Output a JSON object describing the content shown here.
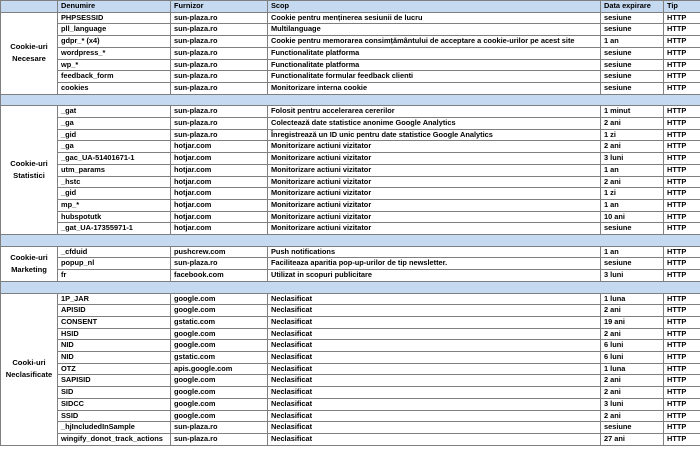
{
  "table": {
    "headers": [
      "",
      "Denumire",
      "Furnizor",
      "Scop",
      "Data expirare",
      "Tip"
    ],
    "groups": [
      {
        "category": "Cookie-uri Necesare",
        "rows": [
          [
            "PHPSESSID",
            "sun-plaza.ro",
            "Cookie pentru menținerea sesiunii de lucru",
            "sesiune",
            "HTTP"
          ],
          [
            "pll_language",
            "sun-plaza.ro",
            "Multilanguage",
            "sesiune",
            "HTTP"
          ],
          [
            "gdpr_* (x4)",
            "sun-plaza.ro",
            "Cookie pentru memorarea consimțământului de acceptare a cookie-urilor pe acest site",
            "1 an",
            "HTTP"
          ],
          [
            "wordpress_*",
            "sun-plaza.ro",
            "Functionalitate platforma",
            "sesiune",
            "HTTP"
          ],
          [
            "wp_*",
            "sun-plaza.ro",
            "Functionalitate platforma",
            "sesiune",
            "HTTP"
          ],
          [
            "feedback_form",
            "sun-plaza.ro",
            "Functionalitate formular feedback clienti",
            "sesiune",
            "HTTP"
          ],
          [
            "cookies",
            "sun-plaza.ro",
            "Monitorizare interna cookie",
            "sesiune",
            "HTTP"
          ]
        ]
      },
      {
        "category": "Cookie-uri Statistici",
        "rows": [
          [
            "_gat",
            "sun-plaza.ro",
            "Folosit pentru accelerarea cererilor",
            "1 minut",
            "HTTP"
          ],
          [
            "_ga",
            "sun-plaza.ro",
            "Colectează date statistice anonime Google Analytics",
            "2 ani",
            "HTTP"
          ],
          [
            "_gid",
            "sun-plaza.ro",
            "Înregistrează un ID unic pentru date statistice Google Analytics",
            "1 zi",
            "HTTP"
          ],
          [
            "_ga",
            "hotjar.com",
            "Monitorizare actiuni vizitator",
            "2 ani",
            "HTTP"
          ],
          [
            "_gac_UA-51401671-1",
            "hotjar.com",
            "Monitorizare actiuni vizitator",
            "3 luni",
            "HTTP"
          ],
          [
            "utm_params",
            "hotjar.com",
            "Monitorizare actiuni vizitator",
            "1 an",
            "HTTP"
          ],
          [
            "_hstc",
            "hotjar.com",
            "Monitorizare actiuni vizitator",
            "2 ani",
            "HTTP"
          ],
          [
            "_gid",
            "hotjar.com",
            "Monitorizare actiuni vizitator",
            "1 zi",
            "HTTP"
          ],
          [
            "mp_*",
            "hotjar.com",
            "Monitorizare actiuni vizitator",
            "1 an",
            "HTTP"
          ],
          [
            "hubspotutk",
            "hotjar.com",
            "Monitorizare actiuni vizitator",
            "10 ani",
            "HTTP"
          ],
          [
            "_gat_UA-17355971-1",
            "hotjar.com",
            "Monitorizare actiuni vizitator",
            "sesiune",
            "HTTP"
          ]
        ]
      },
      {
        "category": "Cookie-uri Marketing",
        "rows": [
          [
            "_cfduid",
            "pushcrew.com",
            "Push notifications",
            "1 an",
            "HTTP"
          ],
          [
            "popup_nl",
            "sun-plaza.ro",
            "Faciliteaza aparitia pop-up-urilor de tip newsletter.",
            "sesiune",
            "HTTP"
          ],
          [
            "fr",
            "facebook.com",
            "Utilizat in scopuri publicitare",
            "3 luni",
            "HTTP"
          ]
        ]
      },
      {
        "category": "Cooki-uri Neclasificate",
        "rows": [
          [
            "1P_JAR",
            "google.com",
            "Neclasificat",
            "1 luna",
            "HTTP"
          ],
          [
            "APISID",
            "google.com",
            "Neclasificat",
            "2 ani",
            "HTTP"
          ],
          [
            "CONSENT",
            "gstatic.com",
            "Neclasificat",
            "19 ani",
            "HTTP"
          ],
          [
            "HSID",
            "google.com",
            "Neclasificat",
            "2 ani",
            "HTTP"
          ],
          [
            "NID",
            "google.com",
            "Neclasificat",
            "6 luni",
            "HTTP"
          ],
          [
            "NID",
            "gstatic.com",
            "Neclasificat",
            "6 luni",
            "HTTP"
          ],
          [
            "OTZ",
            "apis.google.com",
            "Neclasificat",
            "1 luna",
            "HTTP"
          ],
          [
            "SAPISID",
            "google.com",
            "Neclasificat",
            "2 ani",
            "HTTP"
          ],
          [
            "SID",
            "google.com",
            "Neclasificat",
            "2 ani",
            "HTTP"
          ],
          [
            "SIDCC",
            "google.com",
            "Neclasificat",
            "3 luni",
            "HTTP"
          ],
          [
            "SSID",
            "google.com",
            "Neclasificat",
            "2 ani",
            "HTTP"
          ],
          [
            "_hjIncludedInSample",
            "sun-plaza.ro",
            "Neclasificat",
            "sesiune",
            "HTTP"
          ],
          [
            "wingify_donot_track_actions",
            "sun-plaza.ro",
            "Neclasificat",
            "27 ani",
            "HTTP"
          ]
        ]
      }
    ]
  },
  "colors": {
    "header_bg": "#c5d9f1",
    "separator_bg": "#c5d9f1",
    "border": "#7f7f7f"
  }
}
